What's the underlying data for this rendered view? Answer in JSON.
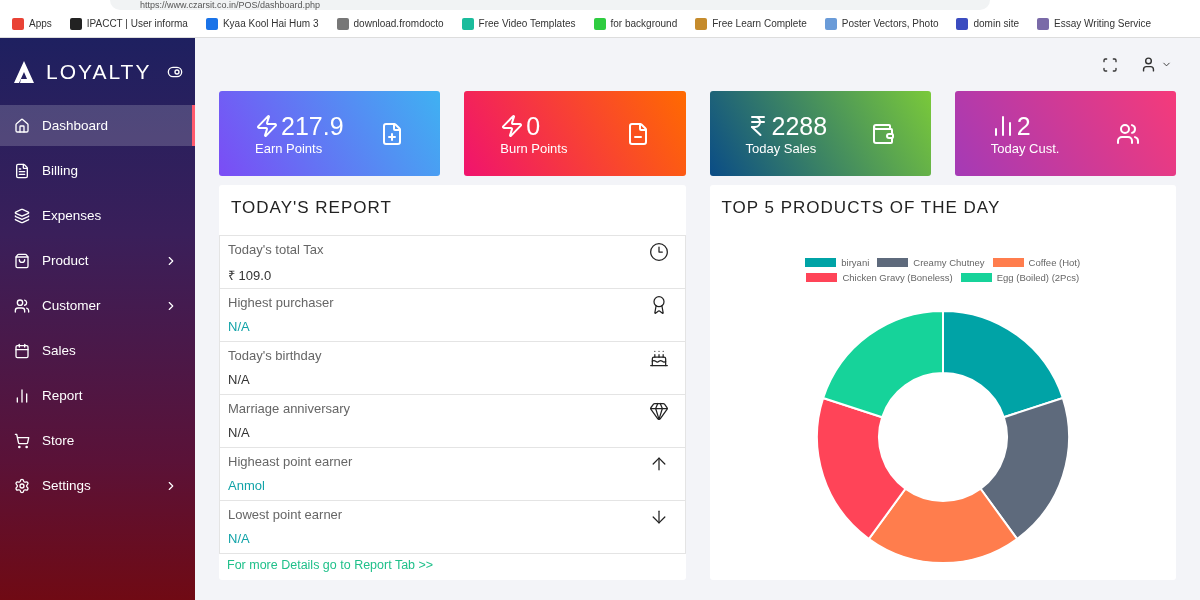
{
  "browser": {
    "url": "https://www.czarsit.co.in/POS/dashboard.php",
    "bookmarks": [
      "Apps",
      "IPACCT | User informa",
      "Kyaa Kool Hai Hum 3",
      "download.fromdocto",
      "Free Video Templates",
      "for background",
      "Free Learn Complete",
      "Poster Vectors, Photo",
      "domin site",
      "Essay Writing Service"
    ]
  },
  "sidebar": {
    "brand": "LOYALTY",
    "items": [
      {
        "label": "Dashboard",
        "selected": true,
        "expandable": false
      },
      {
        "label": "Billing",
        "selected": false,
        "expandable": false
      },
      {
        "label": "Expenses",
        "selected": false,
        "expandable": false
      },
      {
        "label": "Product",
        "selected": false,
        "expandable": true
      },
      {
        "label": "Customer",
        "selected": false,
        "expandable": true
      },
      {
        "label": "Sales",
        "selected": false,
        "expandable": false
      },
      {
        "label": "Report",
        "selected": false,
        "expandable": false
      },
      {
        "label": "Store",
        "selected": false,
        "expandable": false
      },
      {
        "label": "Settings",
        "selected": false,
        "expandable": true
      }
    ]
  },
  "stat_cards": [
    {
      "value": "217.9",
      "label": "Earn Points"
    },
    {
      "value": "0",
      "label": "Burn Points"
    },
    {
      "value": "2288",
      "label": "Today Sales"
    },
    {
      "value": "2",
      "label": "Today Cust."
    }
  ],
  "report": {
    "title": "TODAY'S REPORT",
    "rows": [
      {
        "label": "Today's total Tax",
        "value": "₹ 109.0",
        "color": "#333333"
      },
      {
        "label": "Highest purchaser",
        "value": "N/A",
        "color": "#11a3a8"
      },
      {
        "label": "Today's birthday",
        "value": "N/A",
        "color": "#333333"
      },
      {
        "label": "Marriage anniversary",
        "value": "N/A",
        "color": "#333333"
      },
      {
        "label": "Higheast point earner",
        "value": "Anmol",
        "color": "#11a3a8"
      },
      {
        "label": "Lowest point earner",
        "value": "N/A",
        "color": "#11a3a8"
      }
    ],
    "link": "For more Details go to Report Tab >>"
  },
  "chart": {
    "title": "TOP 5 PRODUCTS OF THE DAY",
    "legend": [
      {
        "label": "biryani",
        "color": "#00a3a6"
      },
      {
        "label": "Creamy Chutney",
        "color": "#5e6a7c"
      },
      {
        "label": "Coffee (Hot)",
        "color": "#ff7d4d"
      },
      {
        "label": "Chicken Gravy (Boneless)",
        "color": "#ff4458"
      },
      {
        "label": "Egg (Boiled) (2Pcs)",
        "color": "#16d39a"
      }
    ]
  }
}
